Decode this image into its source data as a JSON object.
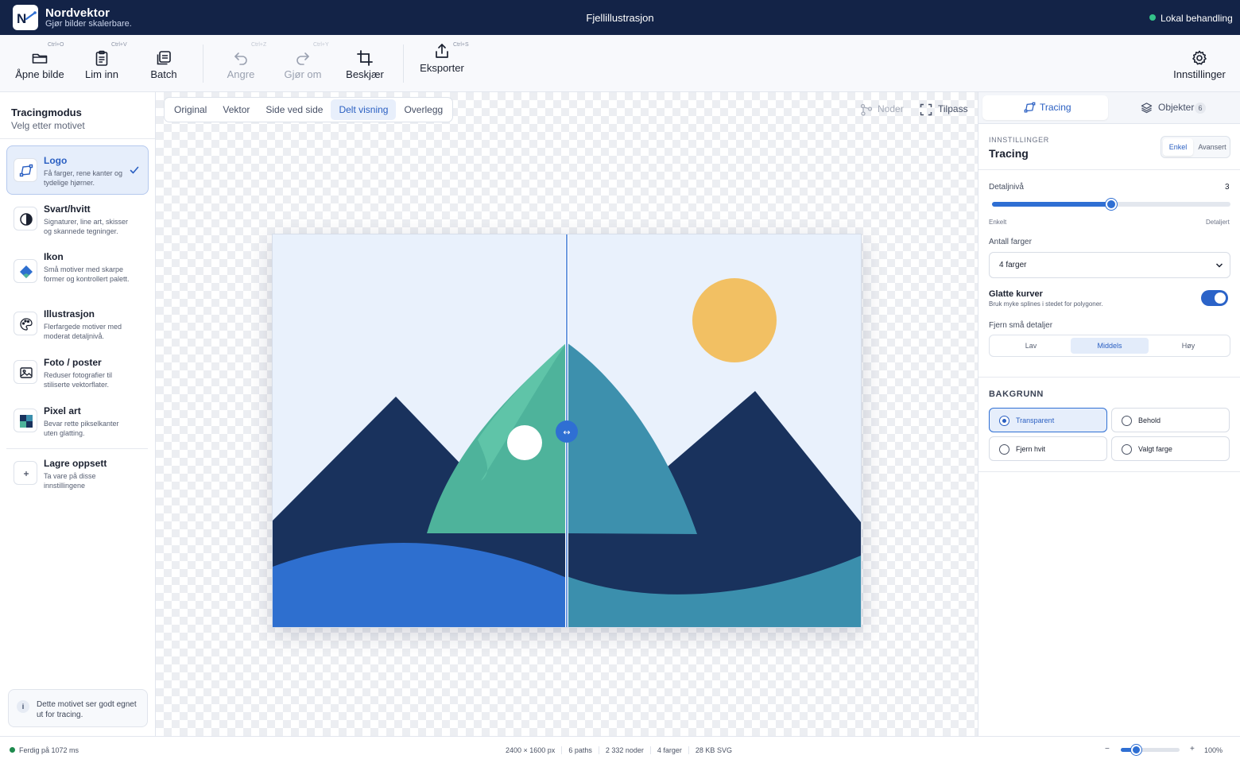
{
  "app": {
    "name": "Nordvektor",
    "tagline": "Gjør bilder skalerbare.",
    "document_title": "Fjellillustrasjon",
    "status": "Lokal behandling",
    "status_color": "#34c28a"
  },
  "toolbar": {
    "open": {
      "label": "Åpne bilde",
      "shortcut": "Ctrl+O",
      "icon": "folder-icon"
    },
    "paste": {
      "label": "Lim inn",
      "shortcut": "Ctrl+V",
      "icon": "clipboard-icon"
    },
    "batch": {
      "label": "Batch",
      "icon": "batch-icon"
    },
    "undo": {
      "label": "Angre",
      "shortcut": "Ctrl+Z",
      "icon": "undo-icon"
    },
    "redo": {
      "label": "Gjør om",
      "shortcut": "Ctrl+Y",
      "icon": "redo-icon"
    },
    "crop": {
      "label": "Beskjær",
      "icon": "crop-icon"
    },
    "export": {
      "label": "Eksporter",
      "shortcut": "Ctrl+S",
      "icon": "export-icon"
    },
    "settings": {
      "label": "Innstillinger",
      "icon": "gear-icon"
    }
  },
  "left_panel": {
    "title": "Tracingmodus",
    "subtitle": "Velg etter motivet",
    "modes": [
      {
        "name": "Logo",
        "desc": "Få farger, rene kanter og tydelige hjørner.",
        "icon": "logo-path-icon",
        "selected": true
      },
      {
        "name": "Svart/hvitt",
        "desc": "Signaturer, line art, skisser og skannede tegninger.",
        "icon": "contrast-icon"
      },
      {
        "name": "Ikon",
        "desc": "Små motiver med skarpe former og kontrollert palett.",
        "icon": "diamond-icon"
      },
      {
        "name": "Illustrasjon",
        "desc": "Flerfargede motiver med moderat detaljnivå.",
        "icon": "palette-icon"
      },
      {
        "name": "Foto / poster",
        "desc": "Reduser fotografier til stiliserte vektorflater.",
        "icon": "image-icon"
      },
      {
        "name": "Pixel art",
        "desc": "Bevar rette pikselkanter uten glatting.",
        "icon": "pixel-icon"
      }
    ],
    "save_preset": {
      "name": "Lagre oppsett",
      "desc": "Ta vare på disse innstillingene",
      "icon": "plus-icon"
    },
    "tip": {
      "icon": "i",
      "text": "Dette motivet ser godt egnet ut for tracing."
    }
  },
  "canvas": {
    "view_tabs": [
      "Original",
      "Vektor",
      "Side ved side",
      "Delt visning",
      "Overlegg"
    ],
    "active_view": "Delt visning",
    "nodes_label": "Noder",
    "fit_label": "Tilpass",
    "split_handle_icon": "↔",
    "colors": {
      "sky": "#e9f1fc",
      "mountain_dark": "#19325d",
      "peak_green": "#4eb39b",
      "peak_green_light": "#5fc4a8",
      "peak_teal": "#3d90ad",
      "water_blue": "#2e6fcf",
      "water_teal": "#3b8fad",
      "sun": "#f2c063",
      "moon": "#ffffff",
      "split_handle": "#2f6fd3"
    }
  },
  "right_panel": {
    "tabs": [
      {
        "label": "Tracing",
        "icon": "tracing-icon",
        "active": true
      },
      {
        "label": "Objekter",
        "icon": "layers-icon",
        "badge": "6"
      }
    ],
    "settings_label": "INNSTILLINGER",
    "settings_title": "Tracing",
    "mode_toggle": [
      "Enkel",
      "Avansert"
    ],
    "mode_active": "Enkel",
    "detail": {
      "label": "Detaljnivå",
      "value": "3",
      "min_label": "Enkelt",
      "max_label": "Detaljert",
      "fraction": 0.5
    },
    "colors_label": "Antall farger",
    "colors_value": "4 farger",
    "smooth": {
      "label": "Glatte kurver",
      "desc": "Bruk myke splines i stedet for polygoner.",
      "on": true
    },
    "remove_details": {
      "label": "Fjern små detaljer",
      "options": [
        "Lav",
        "Middels",
        "Høy"
      ],
      "active": "Middels"
    },
    "background": {
      "title": "BAKGRUNN",
      "options": [
        "Transparent",
        "Behold",
        "Fjern hvit",
        "Valgt farge"
      ],
      "selected": "Transparent"
    }
  },
  "status_bar": {
    "done": "Ferdig på 1072 ms",
    "dimensions": "2400 × 1600 px",
    "paths": "6 paths",
    "nodes": "2 332 noder",
    "colors": "4 farger",
    "size": "28 KB SVG",
    "zoom": "100%",
    "zoom_fraction": 0.25,
    "zoom_minus": "−",
    "zoom_plus": "+"
  }
}
